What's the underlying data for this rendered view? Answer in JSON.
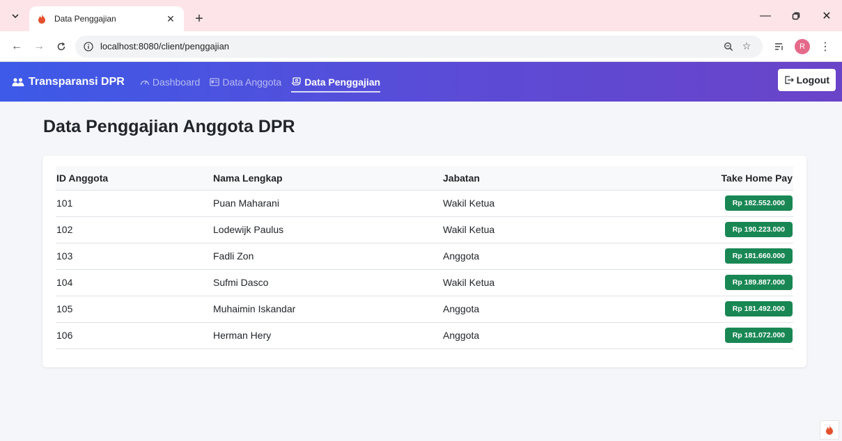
{
  "browser": {
    "tab_title": "Data Penggajian",
    "url": "localhost:8080/client/penggajian",
    "profile_initial": "R"
  },
  "navbar": {
    "brand": "Transparansi DPR",
    "links": [
      {
        "label": "Dashboard"
      },
      {
        "label": "Data Anggota"
      },
      {
        "label": "Data Penggajian"
      }
    ],
    "logout_label": "Logout"
  },
  "page": {
    "title": "Data Penggajian Anggota DPR"
  },
  "table": {
    "headers": [
      "ID Anggota",
      "Nama Lengkap",
      "Jabatan",
      "Take Home Pay"
    ],
    "rows": [
      {
        "id": "101",
        "nama": "Puan Maharani",
        "jabatan": "Wakil Ketua",
        "thp": "Rp 182.552.000"
      },
      {
        "id": "102",
        "nama": "Lodewijk Paulus",
        "jabatan": "Wakil Ketua",
        "thp": "Rp 190.223.000"
      },
      {
        "id": "103",
        "nama": "Fadli Zon",
        "jabatan": "Anggota",
        "thp": "Rp 181.660.000"
      },
      {
        "id": "104",
        "nama": "Sufmi Dasco",
        "jabatan": "Wakil Ketua",
        "thp": "Rp 189.887.000"
      },
      {
        "id": "105",
        "nama": "Muhaimin Iskandar",
        "jabatan": "Anggota",
        "thp": "Rp 181.492.000"
      },
      {
        "id": "106",
        "nama": "Herman Hery",
        "jabatan": "Anggota",
        "thp": "Rp 181.072.000"
      }
    ]
  },
  "colors": {
    "navbar_start": "#3d5ae8",
    "navbar_end": "#6a44c8",
    "badge": "#198754",
    "tabbar": "#fde4e8"
  }
}
